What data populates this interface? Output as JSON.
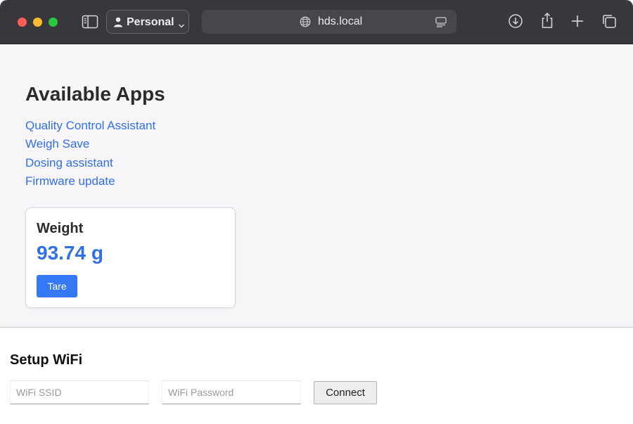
{
  "browser": {
    "profile_label": "Personal",
    "url": "hds.local",
    "icons": {
      "sidebar": "sidebar-icon",
      "profile": "person-icon",
      "site": "globe-icon",
      "reader": "reader-mode-icon",
      "download": "download-icon",
      "share": "share-icon",
      "new_tab": "plus-icon",
      "tab_overview": "tab-overview-icon"
    }
  },
  "main": {
    "title": "Available Apps",
    "apps": [
      "Quality Control Assistant",
      "Weigh Save",
      "Dosing assistant",
      "Firmware update"
    ],
    "weight_card": {
      "title": "Weight",
      "reading": "93.74 g",
      "tare_label": "Tare"
    }
  },
  "wifi": {
    "title": "Setup WiFi",
    "ssid_placeholder": "WiFi SSID",
    "ssid_value": "",
    "password_placeholder": "WiFi Password",
    "password_value": "",
    "connect_label": "Connect"
  },
  "colors": {
    "link": "#2f6fe8",
    "accent": "#3478f6",
    "toolbar": "#38373c"
  }
}
